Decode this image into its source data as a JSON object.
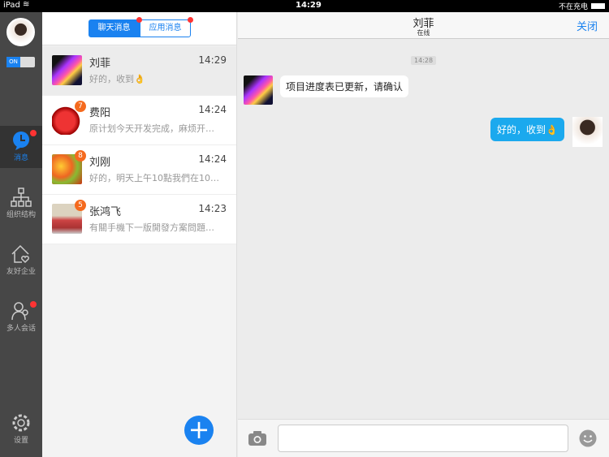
{
  "status": {
    "device": "iPad",
    "time": "14:29",
    "battery": "不在充电"
  },
  "sidebar": {
    "toggle": "ON",
    "items": [
      {
        "label": "消息"
      },
      {
        "label": "组织结构"
      },
      {
        "label": "友好企业"
      },
      {
        "label": "多人会话"
      },
      {
        "label": "设置"
      }
    ]
  },
  "list": {
    "tabs": [
      "聊天消息",
      "应用消息"
    ],
    "conversations": [
      {
        "name": "刘菲",
        "time": "14:29",
        "preview": "好的，收到👌"
      },
      {
        "name": "费阳",
        "time": "14:24",
        "preview": "原计划今天开发完成，麻烦开…",
        "badge": "7"
      },
      {
        "name": "刘刚",
        "time": "14:24",
        "preview": "好的，明天上午10點我們在10…",
        "badge": "8"
      },
      {
        "name": "张鸿飞",
        "time": "14:23",
        "preview": "有關手機下一版開發方案問題…",
        "badge": "5"
      }
    ]
  },
  "chat": {
    "title": "刘菲",
    "subtitle": "在线",
    "close": "关闭",
    "timestamp": "14:28",
    "messages": [
      {
        "from": "other",
        "text": "项目进度表已更新，请确认"
      },
      {
        "from": "me",
        "text": "好的，收到👌"
      }
    ]
  },
  "colors": {
    "accent": "#1a82f0",
    "bubble_me": "#1ba9ee",
    "badge": "#f56a1e"
  }
}
